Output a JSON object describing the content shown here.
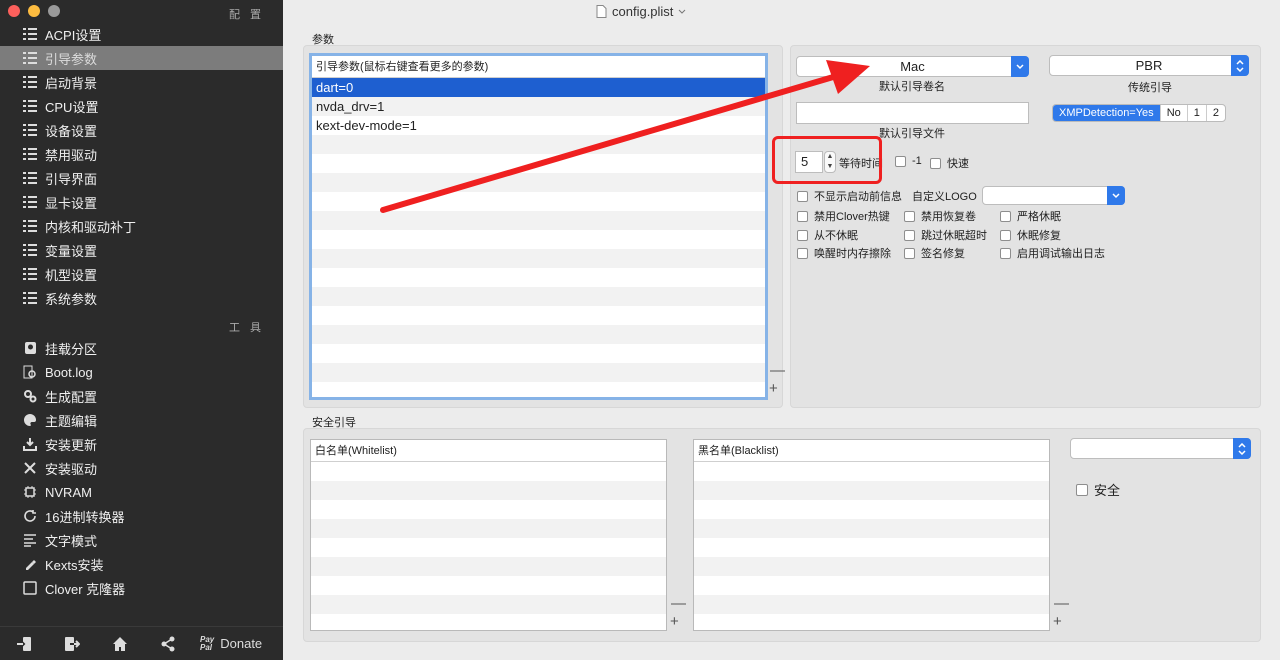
{
  "window": {
    "title": "config.plist"
  },
  "sidebar": {
    "config_header": "配置",
    "tools_header": "工具",
    "config_items": [
      {
        "label": "ACPI设置"
      },
      {
        "label": "引导参数"
      },
      {
        "label": "启动背景"
      },
      {
        "label": "CPU设置"
      },
      {
        "label": "设备设置"
      },
      {
        "label": "禁用驱动"
      },
      {
        "label": "引导界面"
      },
      {
        "label": "显卡设置"
      },
      {
        "label": "内核和驱动补丁"
      },
      {
        "label": "变量设置"
      },
      {
        "label": "机型设置"
      },
      {
        "label": "系统参数"
      }
    ],
    "tool_items": [
      {
        "label": "挂载分区"
      },
      {
        "label": "Boot.log"
      },
      {
        "label": "生成配置"
      },
      {
        "label": "主题编辑"
      },
      {
        "label": "安装更新"
      },
      {
        "label": "安装驱动"
      },
      {
        "label": "NVRAM"
      },
      {
        "label": "16进制转换器"
      },
      {
        "label": "文字模式"
      },
      {
        "label": "Kexts安装"
      },
      {
        "label": "Clover 克隆器"
      }
    ],
    "donate": {
      "pay": "Pay",
      "pal": "Pal",
      "label": "Donate"
    }
  },
  "args": {
    "group_label": "参数",
    "table_header": "引导参数(鼠标右键查看更多的参数)",
    "rows": [
      "dart=0",
      "nvda_drv=1",
      "kext-dev-mode=1"
    ]
  },
  "boot": {
    "default_volume": "Mac",
    "default_volume_caption": "默认引导卷名",
    "legacy": "PBR",
    "legacy_caption": "传统引导",
    "default_loader_caption": "默认引导文件",
    "xmp": [
      "XMPDetection=Yes",
      "No",
      "1",
      "2"
    ],
    "timeout_value": "5",
    "timeout_label": "等待时间",
    "minus_one": "-1",
    "fast": "快速",
    "no_early_progress": "不显示启动前信息",
    "custom_logo": "自定义LOGO",
    "checkboxes": [
      [
        "禁用Clover热键",
        "禁用恢复卷",
        "严格休眠"
      ],
      [
        "从不休眠",
        "跳过休眠超时",
        "休眠修复"
      ],
      [
        "唤醒时内存擦除",
        "签名修复",
        "启用调试输出日志"
      ]
    ]
  },
  "secure": {
    "group_label": "安全引导",
    "whitelist_header": "白名单(Whitelist)",
    "blacklist_header": "黑名单(Blacklist)",
    "secure_label": "安全"
  },
  "colors": {
    "accent": "#2f79ea",
    "selection": "#1e5fd0",
    "annotation": "#ef2020",
    "sidebar_bg": "#2b2b2b"
  }
}
